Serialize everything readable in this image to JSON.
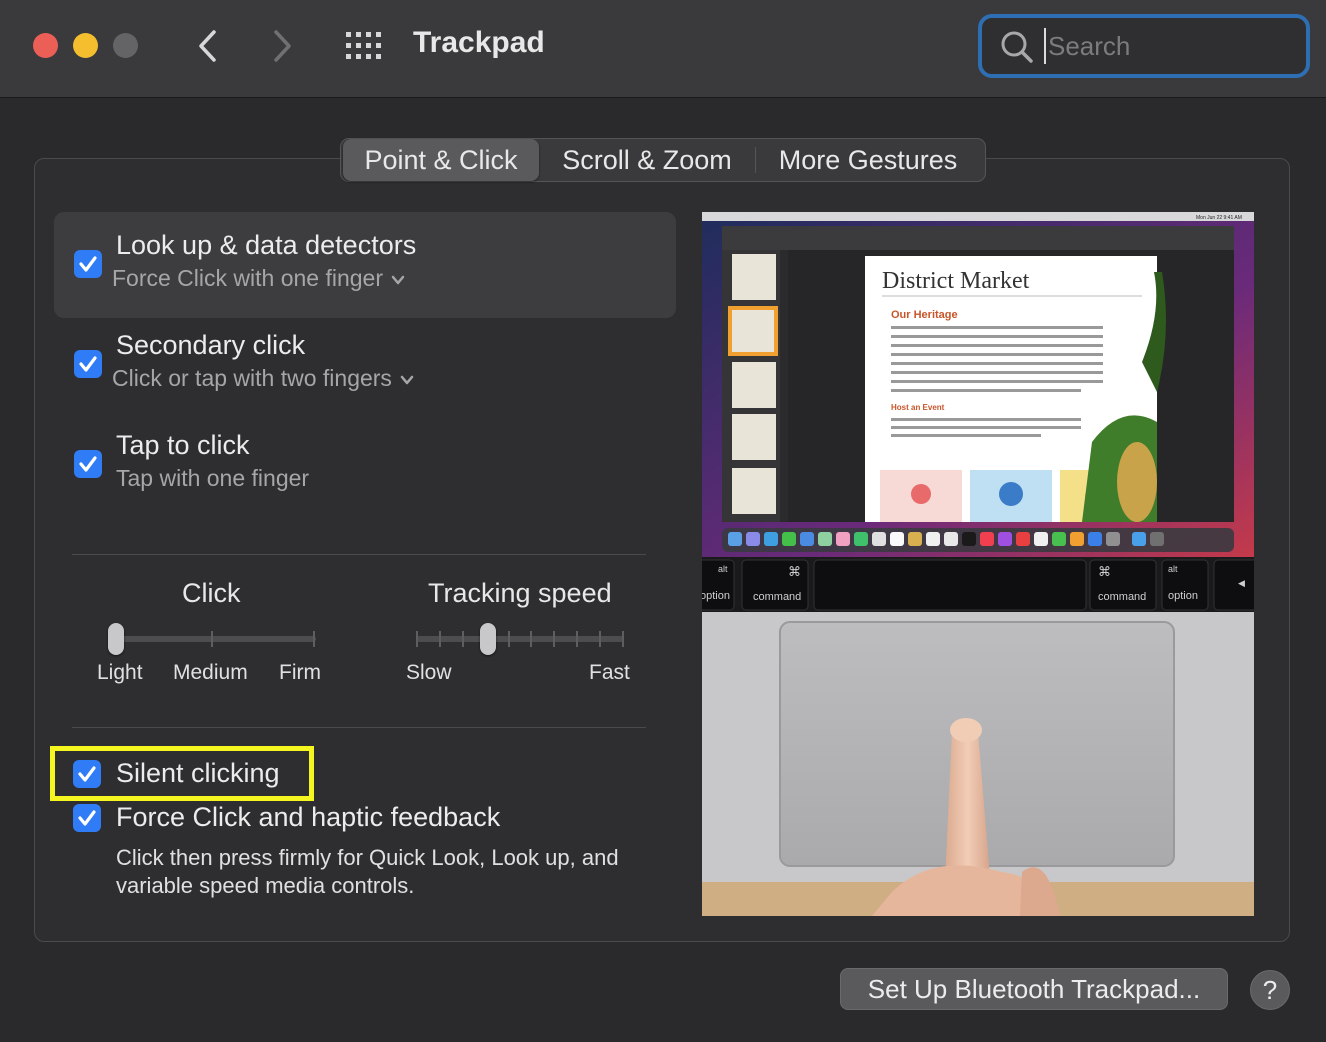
{
  "window": {
    "title": "Trackpad",
    "search_placeholder": "Search"
  },
  "tabs": [
    {
      "label": "Point & Click",
      "active": true
    },
    {
      "label": "Scroll & Zoom",
      "active": false
    },
    {
      "label": "More Gestures",
      "active": false
    }
  ],
  "options": {
    "lookup": {
      "title": "Look up & data detectors",
      "sub": "Force Click with one finger",
      "checked": true
    },
    "secondary": {
      "title": "Secondary click",
      "sub": "Click or tap with two fingers",
      "checked": true
    },
    "tap": {
      "title": "Tap to click",
      "sub": "Tap with one finger",
      "checked": true
    },
    "silent": {
      "title": "Silent clicking",
      "checked": true
    },
    "force": {
      "title": "Force Click and haptic feedback",
      "desc": "Click then press firmly for Quick Look, Look up, and variable speed media controls.",
      "checked": true
    }
  },
  "sliders": {
    "click": {
      "title": "Click",
      "labels": [
        "Light",
        "Medium",
        "Firm"
      ],
      "value": "Light"
    },
    "tracking": {
      "title": "Tracking speed",
      "labels": [
        "Slow",
        "Fast"
      ],
      "value_fraction": 0.35
    }
  },
  "preview": {
    "doc_title": "District Market",
    "heritage_heading": "Our Heritage",
    "event_heading": "Host an Event",
    "key_labels": [
      "option",
      "command",
      "command",
      "option"
    ],
    "key_symbols": [
      "alt",
      "⌘",
      "⌘",
      "alt"
    ],
    "menu_date": "Mon Jun 22  9:41 AM"
  },
  "footer": {
    "bluetooth_button": "Set Up Bluetooth Trackpad...",
    "help_button": "?"
  },
  "colors": {
    "accent": "#2f7cf6",
    "search_focus": "#2e6fb4",
    "highlight_box": "#f5f51f"
  }
}
